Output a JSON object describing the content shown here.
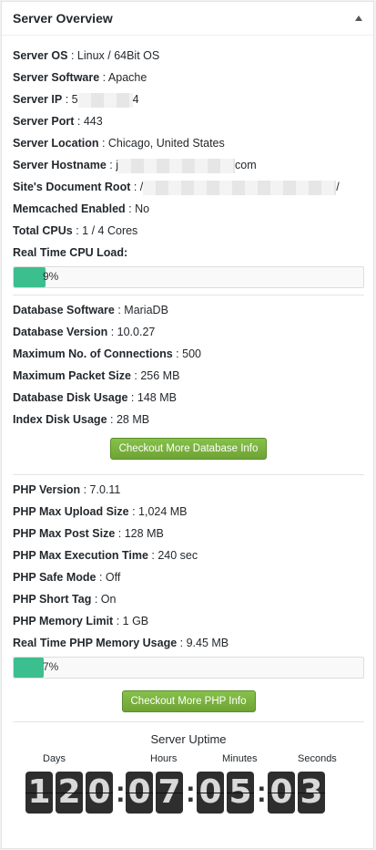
{
  "panel": {
    "title": "Server Overview",
    "toggle_icon": "triangle-up-icon"
  },
  "server": [
    {
      "label": "Server OS",
      "value": "Linux / 64Bit OS"
    },
    {
      "label": "Server Software",
      "value": "Apache"
    },
    {
      "label": "Server IP",
      "value_prefix": "5",
      "value_suffix": "4"
    },
    {
      "label": "Server Port",
      "value": "443"
    },
    {
      "label": "Server Location",
      "value": "Chicago, United States"
    },
    {
      "label": "Server Hostname",
      "value_prefix": "j",
      "value_suffix": "com"
    },
    {
      "label": "Site's Document Root",
      "value_prefix": "/",
      "value_suffix": "/"
    },
    {
      "label": "Memcached Enabled",
      "value": "No"
    },
    {
      "label": "Total CPUs",
      "value": "1 / 4 Cores"
    },
    {
      "label": "Real Time CPU Load:"
    }
  ],
  "cpu_load": {
    "percent": 9,
    "text": "9%"
  },
  "database": [
    {
      "label": "Database Software",
      "value": "MariaDB"
    },
    {
      "label": "Database Version",
      "value": "10.0.27"
    },
    {
      "label": "Maximum No. of Connections",
      "value": "500"
    },
    {
      "label": "Maximum Packet Size",
      "value": "256 MB"
    },
    {
      "label": "Database Disk Usage",
      "value": "148 MB"
    },
    {
      "label": "Index Disk Usage",
      "value": "28 MB"
    }
  ],
  "db_button": "Checkout More Database Info",
  "php": [
    {
      "label": "PHP Version",
      "value": "7.0.11"
    },
    {
      "label": "PHP Max Upload Size",
      "value": "1,024 MB"
    },
    {
      "label": "PHP Max Post Size",
      "value": "128 MB"
    },
    {
      "label": "PHP Max Execution Time",
      "value": "240 sec"
    },
    {
      "label": "PHP Safe Mode",
      "value": "Off"
    },
    {
      "label": "PHP Short Tag",
      "value": "On"
    },
    {
      "label": "PHP Memory Limit",
      "value": "1 GB"
    },
    {
      "label": "Real Time PHP Memory Usage",
      "value": "9.45 MB"
    }
  ],
  "php_memory": {
    "percent": 7,
    "text": "7%"
  },
  "php_button": "Checkout More PHP Info",
  "uptime": {
    "title": "Server Uptime",
    "labels": {
      "days": "Days",
      "hours": "Hours",
      "minutes": "Minutes",
      "seconds": "Seconds"
    },
    "digits": [
      "1",
      "2",
      "0",
      "0",
      "7",
      "0",
      "5",
      "0",
      "3"
    ]
  },
  "colors": {
    "progress": "#3bbf8e",
    "button": "#7cb342",
    "digit_bg": "#2e2e2e"
  }
}
